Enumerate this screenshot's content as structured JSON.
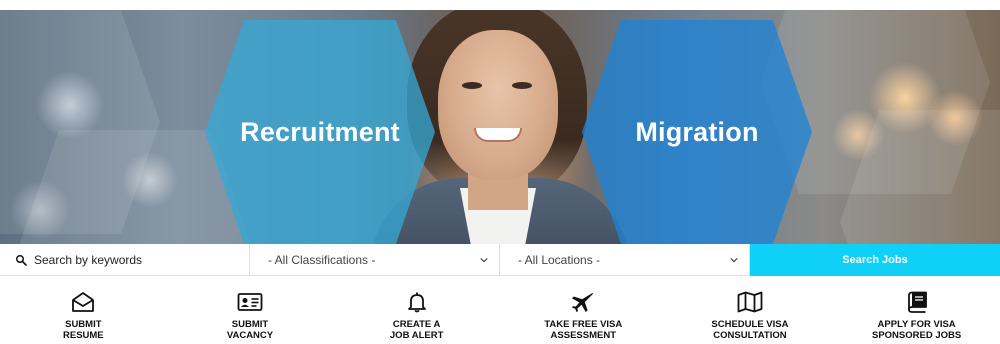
{
  "hero": {
    "left_title": "Recruitment",
    "right_title": "Migration",
    "left_color": "#34a8d6",
    "right_color": "#1c84d8"
  },
  "search": {
    "keywords_placeholder": "Search by keywords",
    "classification_selected": "- All Classifications -",
    "location_selected": "- All Locations -",
    "submit_label": "Search Jobs",
    "submit_color": "#0fd1f7"
  },
  "actions": [
    {
      "icon": "envelope-open-icon",
      "line1": "SUBMIT",
      "line2": "RESUME"
    },
    {
      "icon": "id-card-icon",
      "line1": "SUBMIT",
      "line2": "VACANCY"
    },
    {
      "icon": "bell-icon",
      "line1": "CREATE A",
      "line2": "JOB ALERT"
    },
    {
      "icon": "plane-icon",
      "line1": "TAKE FREE VISA",
      "line2": "ASSESSMENT"
    },
    {
      "icon": "map-icon",
      "line1": "SCHEDULE VISA",
      "line2": "CONSULTATION"
    },
    {
      "icon": "book-icon",
      "line1": "APPLY FOR VISA",
      "line2": "SPONSORED JOBS"
    }
  ]
}
